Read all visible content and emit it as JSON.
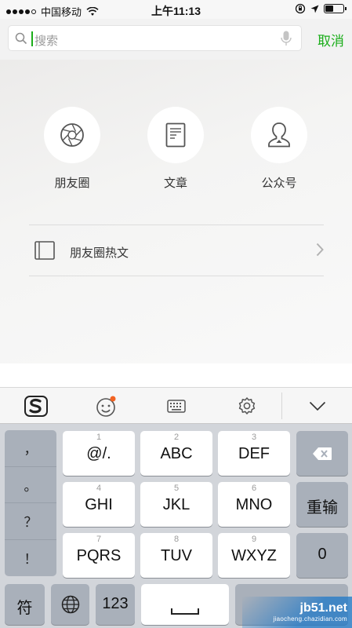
{
  "status_bar": {
    "carrier": "中国移动",
    "time": "上午11:13"
  },
  "search": {
    "placeholder": "搜索",
    "cancel_label": "取消"
  },
  "categories": [
    {
      "label": "朋友圈",
      "icon": "camera-aperture-icon"
    },
    {
      "label": "文章",
      "icon": "document-icon"
    },
    {
      "label": "公众号",
      "icon": "person-icon"
    }
  ],
  "hot_articles": {
    "label": "朋友圈热文",
    "icon": "book-icon"
  },
  "keyboard_toolbar": {
    "items": [
      "sogou-logo-icon",
      "emoji-icon",
      "keyboard-icon",
      "gear-icon",
      "collapse-icon"
    ]
  },
  "keyboard": {
    "punctuation": [
      "，",
      "。",
      "？",
      "！"
    ],
    "keys": [
      {
        "num": "1",
        "label": "@/."
      },
      {
        "num": "2",
        "label": "ABC"
      },
      {
        "num": "3",
        "label": "DEF"
      },
      {
        "num": "4",
        "label": "GHI"
      },
      {
        "num": "5",
        "label": "JKL"
      },
      {
        "num": "6",
        "label": "MNO"
      },
      {
        "num": "7",
        "label": "PQRS"
      },
      {
        "num": "8",
        "label": "TUV"
      },
      {
        "num": "9",
        "label": "WXYZ"
      }
    ],
    "reenter_label": "重输",
    "zero_label": "0",
    "symbols_label": "符",
    "numbers_label": "123"
  },
  "watermark": {
    "text": "jb51.net",
    "subtext": "jiaocheng.chazidian.com"
  },
  "colors": {
    "accent": "#1aad19",
    "keyboard_bg": "#d2d5da",
    "function_key": "#a9b0ba"
  }
}
